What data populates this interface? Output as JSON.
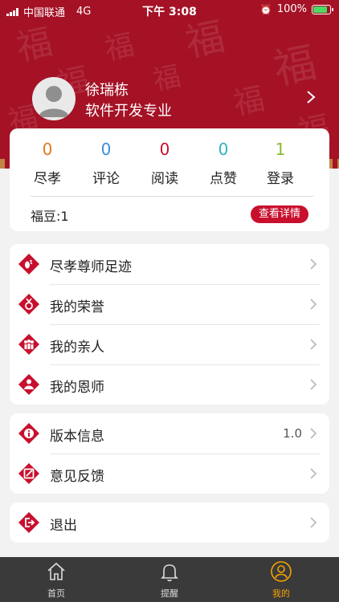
{
  "status_bar": {
    "carrier": "中国联通",
    "network": "4G",
    "time": "下午 3:08",
    "battery": "100%",
    "battery_level": 1.0
  },
  "profile": {
    "name": "徐瑞栋",
    "major": "软件开发专业",
    "avatar_icon": "user-avatar-icon",
    "chevron_icon": "chevron-right-icon"
  },
  "stats": [
    {
      "value": "0",
      "label": "尽孝",
      "color": "#e07a1f"
    },
    {
      "value": "0",
      "label": "评论",
      "color": "#3a8fd8"
    },
    {
      "value": "0",
      "label": "阅读",
      "color": "#c8102e"
    },
    {
      "value": "0",
      "label": "点赞",
      "color": "#2fb3c1"
    },
    {
      "value": "1",
      "label": "登录",
      "color": "#8ab92d"
    }
  ],
  "fudou": {
    "label": "福豆:1",
    "button": "查看详情"
  },
  "menu_group_1": [
    {
      "label": "尽孝尊师足迹",
      "icon": "footprint-icon"
    },
    {
      "label": "我的荣誉",
      "icon": "medal-icon"
    },
    {
      "label": "我的亲人",
      "icon": "family-icon"
    },
    {
      "label": "我的恩师",
      "icon": "teacher-icon"
    }
  ],
  "menu_group_2": [
    {
      "label": "版本信息",
      "value": "1.0",
      "icon": "info-icon"
    },
    {
      "label": "意见反馈",
      "value": "",
      "icon": "feedback-icon"
    }
  ],
  "menu_group_3": [
    {
      "label": "退出",
      "icon": "logout-icon"
    }
  ],
  "tabbar": [
    {
      "label": "首页",
      "icon": "home-icon",
      "active": false
    },
    {
      "label": "提醒",
      "icon": "bell-icon",
      "active": false
    },
    {
      "label": "我的",
      "icon": "person-icon",
      "active": true
    }
  ],
  "colors": {
    "brand_red": "#a51226",
    "accent_red": "#c8102e",
    "tab_active": "#f4a300"
  }
}
